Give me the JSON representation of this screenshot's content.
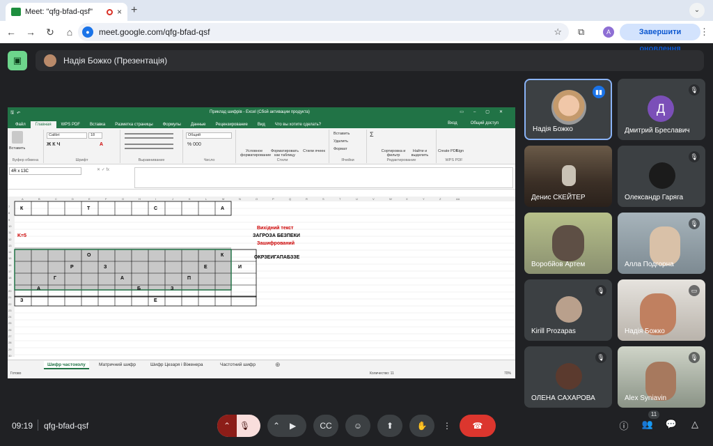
{
  "browser": {
    "tab_title": "Meet: \"qfg-bfad-qsf\"",
    "tab_close": "×",
    "new_tab": "+",
    "url": "meet.google.com/qfg-bfad-qsf",
    "account_initial": "A",
    "update_label": "Завершити оновлення"
  },
  "meet": {
    "presenter_label": "Надія Божко (Презентація)",
    "time": "09:19",
    "meeting_code": "qfg-bfad-qsf",
    "participants_count": "11"
  },
  "excel": {
    "window_title": "Приклад шифрів - Excel (Сбой активации продукта)",
    "menu": [
      "Файл",
      "Главная",
      "WPS PDF",
      "Вставка",
      "Разметка страницы",
      "Формулы",
      "Данные",
      "Рецензирование",
      "Вид",
      "Что вы хотите сделать?"
    ],
    "menu_right": [
      "Вход",
      "Общий доступ"
    ],
    "groups": [
      "Буфер обмена",
      "Шрифт",
      "Выравнивание",
      "Число",
      "Стили",
      "Ячейки",
      "Редактирование",
      "WPS PDF"
    ],
    "font_name": "Calibri",
    "font_size": "18",
    "number_format": "Общий",
    "paste_label": "Вставить",
    "style_buttons": [
      "Условное форматирование",
      "Форматировать как таблицу",
      "Стили ячеек"
    ],
    "cells_buttons": [
      "Вставить",
      "Удалить",
      "Формат"
    ],
    "edit_buttons": [
      "Сортировка и фильтр",
      "Найти и выделить"
    ],
    "wps_buttons": [
      "Create PDF",
      "Sign"
    ],
    "name_box": "4R x 13C",
    "columns": [
      "A",
      "B",
      "C",
      "D",
      "E",
      "F",
      "G",
      "H",
      "I",
      "J",
      "K",
      "L",
      "M",
      "N",
      "O",
      "P",
      "Q",
      "R",
      "S",
      "T",
      "U",
      "V",
      "W",
      "X",
      "Y",
      "Z",
      "AA"
    ],
    "rows": [
      "7",
      "8",
      "9",
      "10",
      "11",
      "12",
      "13",
      "14",
      "15",
      "16",
      "17",
      "18",
      "19",
      "20",
      "21",
      "22",
      "23",
      "24",
      "25",
      "26",
      "27",
      "28",
      "29",
      "30"
    ],
    "k_label": "K=5",
    "source_label": "Вихідний текст",
    "source_text": "ЗАГРОЗА БЕЗПЕКИ",
    "encrypted_label": "Зашифрований",
    "encrypted_text": "ОКРЗЕИГАПАБЗЗЕ",
    "row7": [
      "К",
      "Т",
      "С",
      "А"
    ],
    "row13": [
      "О",
      "К"
    ],
    "row14": [
      "Р",
      "З",
      "Е",
      "И"
    ],
    "row15": [
      "Г",
      "А",
      "П"
    ],
    "row16": [
      "А",
      "Б",
      "З"
    ],
    "row17": [
      "З",
      "Е"
    ],
    "sheets": [
      "Шифр частоколу",
      "Матричний шифр",
      "Шифр Цезаря і Віженера",
      "Частотний шифр"
    ],
    "status_ready": "Готово",
    "status_count": "Количество: 11",
    "zoom": "70%"
  },
  "participants": [
    {
      "name": "Надія Божко",
      "kind": "avatar"
    },
    {
      "name": "Дмитрий Бреславич",
      "kind": "letter",
      "letter": "Д"
    },
    {
      "name": "Денис СКЕЙТЕР",
      "kind": "video"
    },
    {
      "name": "Олександр Гаряга",
      "kind": "avatar"
    },
    {
      "name": "Воробйов Артем",
      "kind": "video"
    },
    {
      "name": "Алла Подгорна",
      "kind": "video"
    },
    {
      "name": "Kirill Prozapas",
      "kind": "avatar"
    },
    {
      "name": "Надія Божко",
      "kind": "video"
    },
    {
      "name": "ОЛЕНА САХАРОВА",
      "kind": "avatar"
    },
    {
      "name": "Alex Syniavin",
      "kind": "video"
    }
  ],
  "colors": {
    "meet_bg": "#202124",
    "excel_green": "#217346",
    "leave_red": "#dc362e",
    "mic_off": "#f9dedc"
  }
}
